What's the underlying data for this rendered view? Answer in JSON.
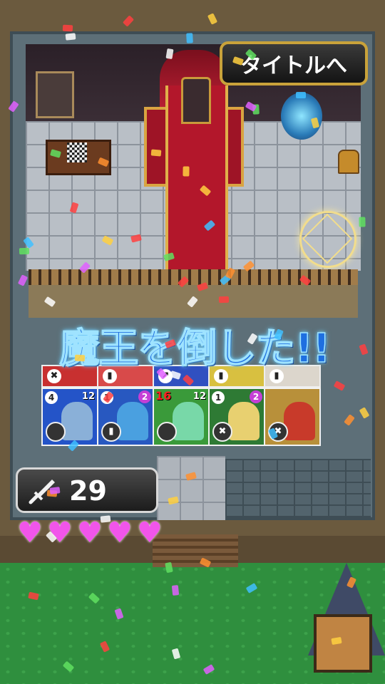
{
  "title_button": {
    "label": "タイトルへ"
  },
  "victory_message": "魔王を倒した!!",
  "attack": {
    "value": "29",
    "icon": "sword-icon"
  },
  "hearts": {
    "count": 5,
    "color": "#f155ea"
  },
  "top_cards": [
    {
      "icon": "✖",
      "color": "#c83030"
    },
    {
      "icon": "▮",
      "color": "#d84a4a"
    },
    {
      "icon": "↗",
      "color": "#3050c0"
    },
    {
      "icon": "▮",
      "color": "#d8c040"
    },
    {
      "icon": "▮",
      "color": "#dcd6cc"
    }
  ],
  "cards": [
    {
      "name": "shark",
      "level": "4",
      "cost": "12",
      "bg": "#2454c8",
      "art": "#8ab0d8",
      "ability": ""
    },
    {
      "name": "mage",
      "level": "1",
      "badge": "2",
      "bg": "#2858c0",
      "art": "#4aa0e0",
      "ability": "▮"
    },
    {
      "name": "green-monster",
      "hp": "16",
      "cost": "12",
      "bg": "#3a9a3a",
      "art": "#78d8a8",
      "ability": ""
    },
    {
      "name": "elf-archer",
      "level": "1",
      "badge": "2",
      "bg": "#2e7a34",
      "art": "#e8d070",
      "ability": "✖"
    },
    {
      "name": "demon-lord",
      "bg": "#b8903a",
      "art": "#c83a2a",
      "ability": "✖"
    }
  ],
  "colors": {
    "accent": "#c9a23a",
    "victory": "#1e6fe0"
  }
}
